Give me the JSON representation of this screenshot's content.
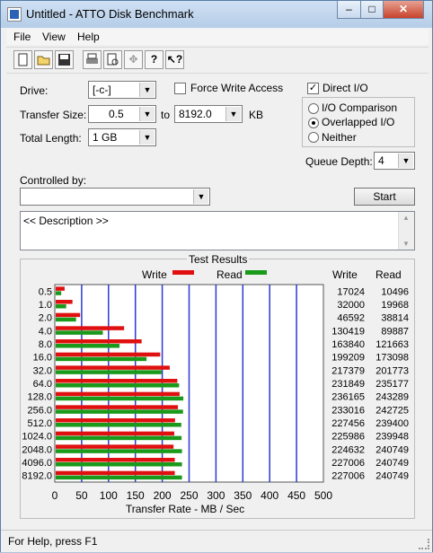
{
  "window": {
    "title": "Untitled - ATTO Disk Benchmark"
  },
  "titlebar_buttons": {
    "minimize": "–",
    "maximize": "□",
    "close": "✕"
  },
  "menu": {
    "file": "File",
    "view": "View",
    "help": "Help"
  },
  "toolbar": {
    "icons": [
      "new-file-icon",
      "open-folder-icon",
      "save-icon",
      "print-icon",
      "print-preview-icon",
      "move-icon",
      "help-icon",
      "context-help-icon"
    ]
  },
  "form": {
    "drive_label": "Drive:",
    "drive_value": "[-c-]",
    "force_write_label": "Force Write Access",
    "direct_io_label": "Direct I/O",
    "transfer_size_label": "Transfer Size:",
    "transfer_from": "0.5",
    "to_label": "to",
    "transfer_to": "8192.0",
    "kb_label": "KB",
    "io_comparison_label": "I/O Comparison",
    "overlapped_io_label": "Overlapped I/O",
    "neither_label": "Neither",
    "total_length_label": "Total Length:",
    "total_length_value": "1 GB",
    "queue_depth_label": "Queue Depth:",
    "queue_depth_value": "4",
    "controlled_by_label": "Controlled by:",
    "controlled_by_value": "",
    "start_label": "Start",
    "description_text": "<< Description >>"
  },
  "results": {
    "title": "Test Results",
    "legend_write": "Write",
    "legend_read": "Read",
    "col_write": "Write",
    "col_read": "Read"
  },
  "status": {
    "text": "For Help, press F1"
  },
  "chart_data": {
    "type": "bar",
    "orientation": "horizontal",
    "categories": [
      "0.5",
      "1.0",
      "2.0",
      "4.0",
      "8.0",
      "16.0",
      "32.0",
      "64.0",
      "128.0",
      "256.0",
      "512.0",
      "1024.0",
      "2048.0",
      "4096.0",
      "8192.0"
    ],
    "series": [
      {
        "name": "Write",
        "color": "#e01010",
        "values": [
          17024,
          32000,
          46592,
          130419,
          163840,
          199209,
          217379,
          231849,
          236165,
          233016,
          227456,
          225986,
          224632,
          227006,
          227006
        ]
      },
      {
        "name": "Read",
        "color": "#1a9a1a",
        "values": [
          10496,
          19968,
          38814,
          89887,
          121663,
          173098,
          201773,
          235177,
          243289,
          242725,
          239400,
          239948,
          240749,
          240749,
          240749
        ]
      }
    ],
    "xlabel": "Transfer Rate - MB / Sec",
    "xticks": [
      "0",
      "50",
      "100",
      "150",
      "200",
      "250",
      "300",
      "350",
      "400",
      "450",
      "500"
    ],
    "xlim": [
      0,
      500
    ],
    "grid": true
  }
}
